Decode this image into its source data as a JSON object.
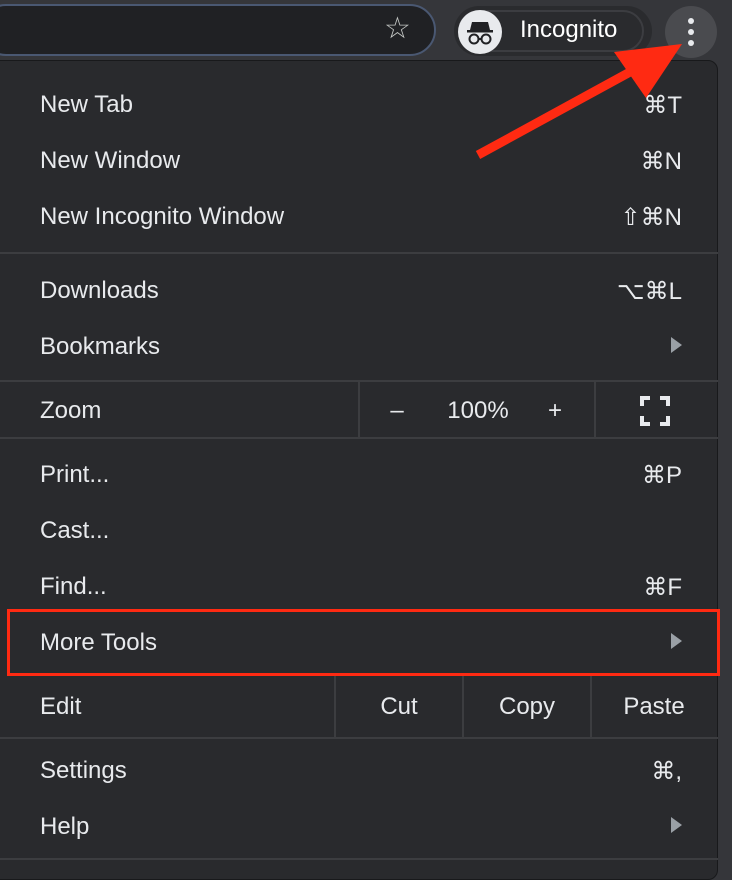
{
  "toolbar": {
    "profile_label": "Incognito",
    "icons": [
      "star-icon",
      "incognito-icon",
      "more-vert-icon"
    ]
  },
  "menu": {
    "new_tab": {
      "label": "New Tab",
      "shortcut": "⌘T"
    },
    "new_window": {
      "label": "New Window",
      "shortcut": "⌘N"
    },
    "new_incognito": {
      "label": "New Incognito Window",
      "shortcut": "⇧⌘N"
    },
    "downloads": {
      "label": "Downloads",
      "shortcut": "⌥⌘L"
    },
    "bookmarks": {
      "label": "Bookmarks"
    },
    "zoom": {
      "label": "Zoom",
      "minus": "–",
      "value": "100%",
      "plus": "+"
    },
    "print": {
      "label": "Print...",
      "shortcut": "⌘P"
    },
    "cast": {
      "label": "Cast..."
    },
    "find": {
      "label": "Find...",
      "shortcut": "⌘F"
    },
    "more_tools": {
      "label": "More Tools"
    },
    "edit": {
      "label": "Edit",
      "cut": "Cut",
      "copy": "Copy",
      "paste": "Paste"
    },
    "settings": {
      "label": "Settings",
      "shortcut": "⌘,"
    },
    "help": {
      "label": "Help"
    }
  },
  "annotation": {
    "highlight_color": "#ff2a12"
  }
}
